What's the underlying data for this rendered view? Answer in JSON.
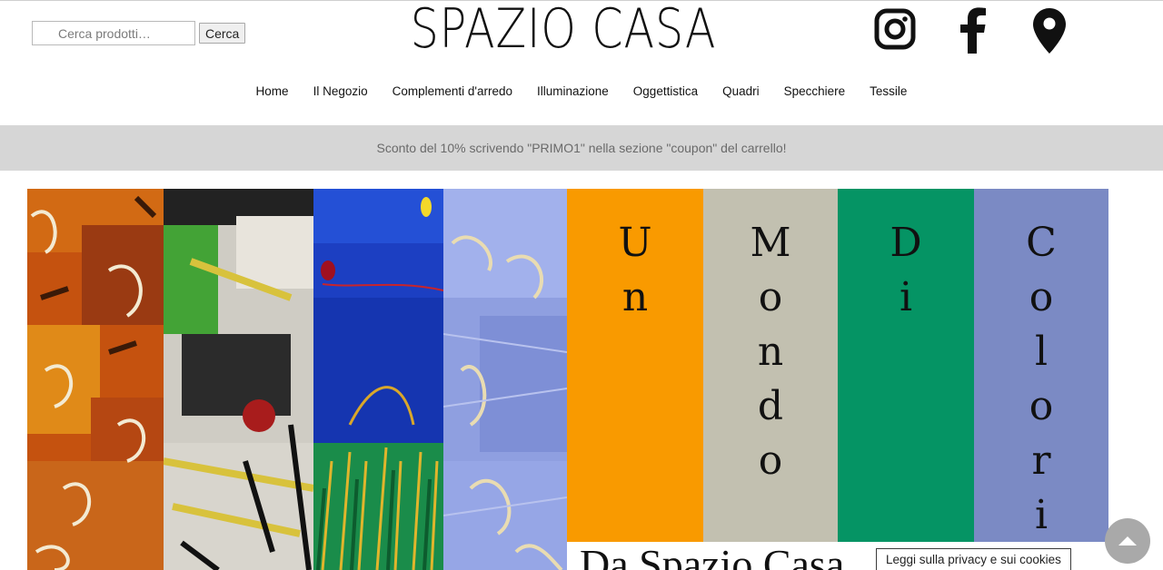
{
  "search": {
    "placeholder": "Cerca prodotti…",
    "button_label": "Cerca"
  },
  "logo": {
    "text": "SPAZIO CASA"
  },
  "social": {
    "icons": [
      "instagram-icon",
      "facebook-icon",
      "location-pin-icon"
    ]
  },
  "nav": {
    "items": [
      {
        "label": "Home"
      },
      {
        "label": "Il Negozio"
      },
      {
        "label": "Complementi d'arredo"
      },
      {
        "label": "Illuminazione"
      },
      {
        "label": "Oggettistica"
      },
      {
        "label": "Quadri"
      },
      {
        "label": "Specchiere"
      },
      {
        "label": "Tessile"
      }
    ]
  },
  "promo": {
    "text": "Sconto del 10% scrivendo \"PRIMO1\" nella sezione \"coupon\" del carrello!"
  },
  "hero": {
    "words": {
      "un": [
        "U",
        "n"
      ],
      "mondo": [
        "M",
        "o",
        "n",
        "d",
        "o"
      ],
      "di": [
        "D",
        "i"
      ],
      "colori": [
        "C",
        "o",
        "l",
        "o",
        "r",
        "i"
      ]
    },
    "subtitle": "Da Spazio Casa",
    "colors": {
      "un": "#f99a00",
      "mondo": "#c2c0b0",
      "di": "#059464",
      "colori": "#7b8ac4"
    }
  },
  "privacy": {
    "label": "Leggi sulla privacy e sui cookies"
  },
  "scroll_top": {
    "icon": "arrow-up-icon"
  }
}
